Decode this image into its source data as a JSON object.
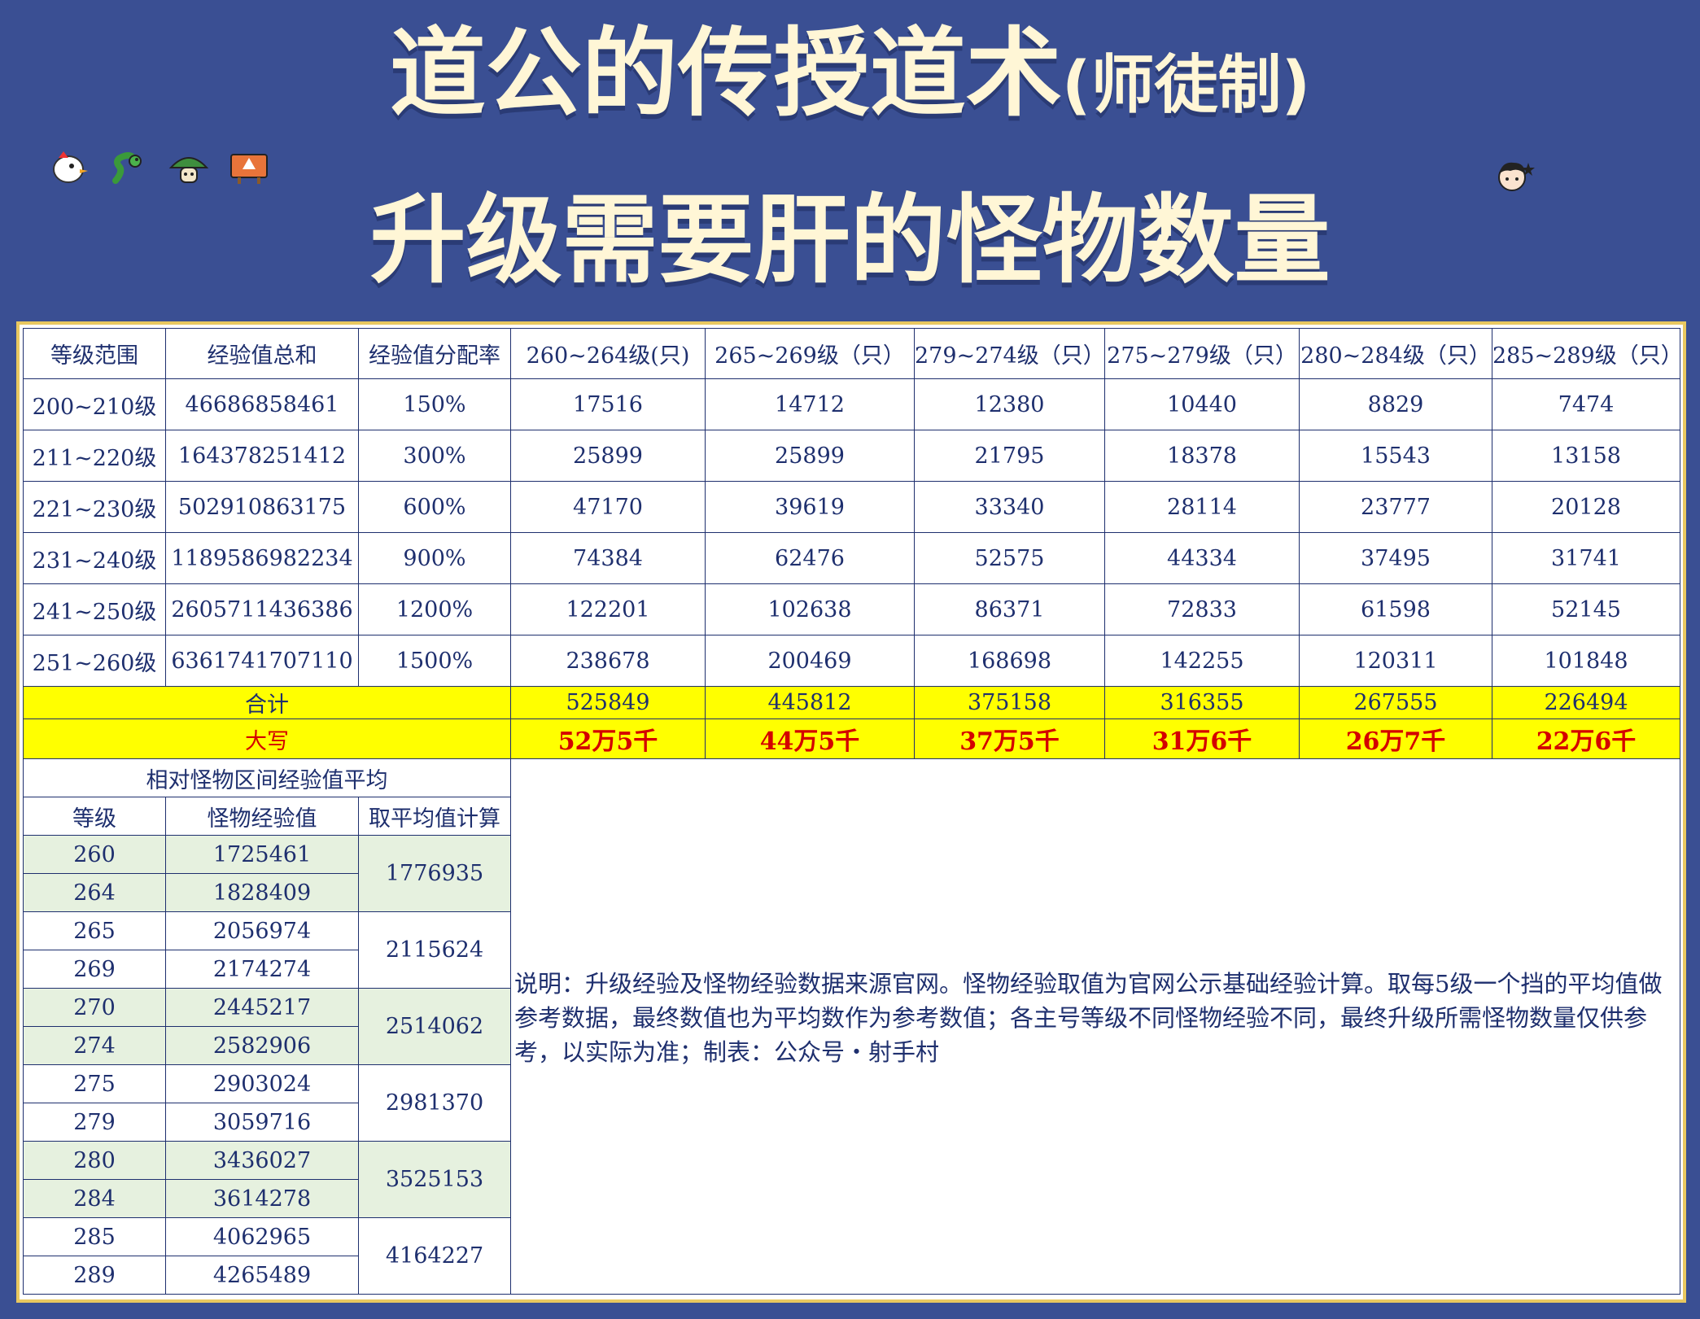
{
  "title": {
    "main": "道公的传授道术",
    "sub": "(师徒制)",
    "line2": "升级需要肝的怪物数量"
  },
  "stickers": [
    "chicken-icon",
    "snake-icon",
    "mushroom-icon",
    "danger-sign-icon"
  ],
  "sticker_right": "face-icon",
  "table": {
    "headers": [
      "等级范围",
      "经验值总和",
      "经验值分配率",
      "260~264级(只)",
      "265~269级（只）",
      "279~274级（只）",
      "275~279级（只）",
      "280~284级（只）",
      "285~289级（只）"
    ],
    "rows": [
      [
        "200~210级",
        "46686858461",
        "150%",
        "17516",
        "14712",
        "12380",
        "10440",
        "8829",
        "7474"
      ],
      [
        "211~220级",
        "164378251412",
        "300%",
        "25899",
        "25899",
        "21795",
        "18378",
        "15543",
        "13158"
      ],
      [
        "221~230级",
        "502910863175",
        "600%",
        "47170",
        "39619",
        "33340",
        "28114",
        "23777",
        "20128"
      ],
      [
        "231~240级",
        "1189586982234",
        "900%",
        "74384",
        "62476",
        "52575",
        "44334",
        "37495",
        "31741"
      ],
      [
        "241~250级",
        "2605711436386",
        "1200%",
        "122201",
        "102638",
        "86371",
        "72833",
        "61598",
        "52145"
      ],
      [
        "251~260级",
        "6361741707110",
        "1500%",
        "238678",
        "200469",
        "168698",
        "142255",
        "120311",
        "101848"
      ]
    ],
    "total_label": "合计",
    "totals": [
      "525849",
      "445812",
      "375158",
      "316355",
      "267555",
      "226494"
    ],
    "caps_label": "大写",
    "caps": [
      "52万5千",
      "44万5千",
      "37万5千",
      "31万6千",
      "26万7千",
      "22万6千"
    ]
  },
  "avg": {
    "title": "相对怪物区间经验值平均",
    "headers": [
      "等级",
      "怪物经验值",
      "取平均值计算"
    ],
    "groups": [
      {
        "rows": [
          [
            "260",
            "1725461"
          ],
          [
            "264",
            "1828409"
          ]
        ],
        "avg": "1776935"
      },
      {
        "rows": [
          [
            "265",
            "2056974"
          ],
          [
            "269",
            "2174274"
          ]
        ],
        "avg": "2115624"
      },
      {
        "rows": [
          [
            "270",
            "2445217"
          ],
          [
            "274",
            "2582906"
          ]
        ],
        "avg": "2514062"
      },
      {
        "rows": [
          [
            "275",
            "2903024"
          ],
          [
            "279",
            "3059716"
          ]
        ],
        "avg": "2981370"
      },
      {
        "rows": [
          [
            "280",
            "3436027"
          ],
          [
            "284",
            "3614278"
          ]
        ],
        "avg": "3525153"
      },
      {
        "rows": [
          [
            "285",
            "4062965"
          ],
          [
            "289",
            "4265489"
          ]
        ],
        "avg": "4164227"
      }
    ]
  },
  "note": "说明：升级经验及怪物经验数据来源官网。怪物经验取值为官网公示基础经验计算。取每5级一个挡的平均值做参考数据，最终数值也为平均数作为参考数值；各主号等级不同怪物经验不同，最终升级所需怪物数量仅供参考，以实际为准；制表：公众号・射手村"
}
